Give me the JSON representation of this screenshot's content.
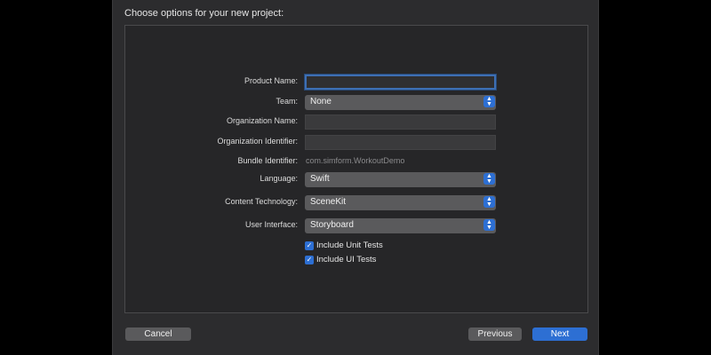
{
  "header": {
    "title": "Choose options for your new project:"
  },
  "form": {
    "product_name": {
      "label": "Product Name:",
      "value": ""
    },
    "team": {
      "label": "Team:",
      "value": "None"
    },
    "organization_name": {
      "label": "Organization Name:",
      "value": ""
    },
    "organization_identifier": {
      "label": "Organization Identifier:",
      "value": ""
    },
    "bundle_identifier": {
      "label": "Bundle Identifier:",
      "value": "com.simform.WorkoutDemo"
    },
    "language": {
      "label": "Language:",
      "value": "Swift"
    },
    "content_technology": {
      "label": "Content Technology:",
      "value": "SceneKit"
    },
    "user_interface": {
      "label": "User Interface:",
      "value": "Storyboard"
    },
    "include_unit_tests": {
      "label": "Include Unit Tests",
      "checked": true
    },
    "include_ui_tests": {
      "label": "Include UI Tests",
      "checked": true
    }
  },
  "footer": {
    "cancel_label": "Cancel",
    "previous_label": "Previous",
    "next_label": "Next"
  },
  "colors": {
    "accent": "#2d6fd3",
    "background": "#2c2c2e",
    "panel": "#262628"
  },
  "icons": {
    "popup_stepper": "chevron-up-down-icon",
    "checkmark": "checkmark-icon"
  }
}
